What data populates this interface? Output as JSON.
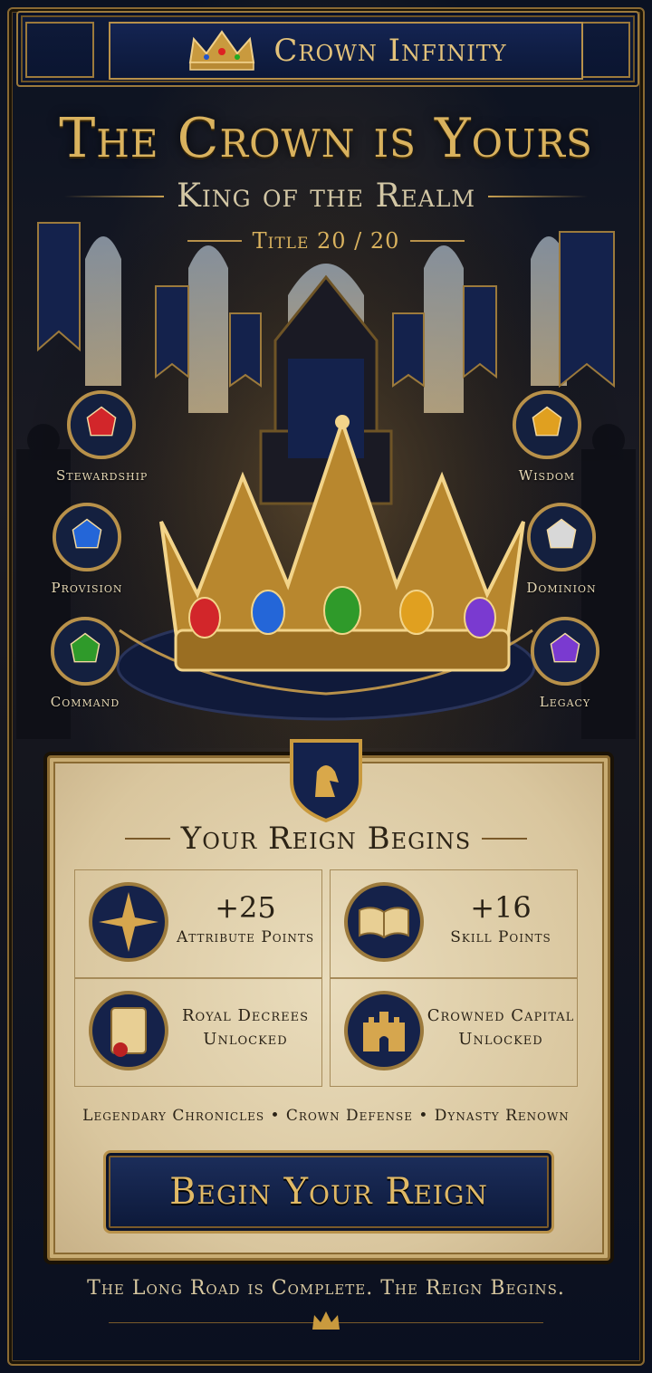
{
  "header": {
    "title": "Crown Infinity"
  },
  "hero": {
    "title": "The Crown is Yours",
    "subtitle": "King of the Realm",
    "level": "Title 20 / 20"
  },
  "attributes": [
    {
      "label": "Stewardship",
      "gem": "#d2262a"
    },
    {
      "label": "Provision",
      "gem": "#2466d8"
    },
    {
      "label": "Command",
      "gem": "#2f9a2a"
    },
    {
      "label": "Wisdom",
      "gem": "#e0a020"
    },
    {
      "label": "Dominion",
      "gem": "#d8d8d8"
    },
    {
      "label": "Legacy",
      "gem": "#7a3ad0"
    }
  ],
  "rewards": {
    "heading": "Your Reign Begins",
    "attribute_points": {
      "value": "+25",
      "label": "Attribute Points"
    },
    "skill_points": {
      "value": "+16",
      "label": "Skill Points"
    },
    "decrees": {
      "line1": "Royal Decrees",
      "line2": "Unlocked"
    },
    "capital": {
      "line1": "Crowned Capital",
      "line2": "Unlocked"
    },
    "features": "Legendary Chronicles  •  Crown Defense  •  Dynasty Renown"
  },
  "cta": {
    "label": "Begin Your Reign"
  },
  "footer": {
    "text": "The Long Road is Complete. The Reign Begins."
  },
  "colors": {
    "gold": "#d9b25e",
    "navy": "#0c1838",
    "parchment": "#e9dcbc"
  }
}
